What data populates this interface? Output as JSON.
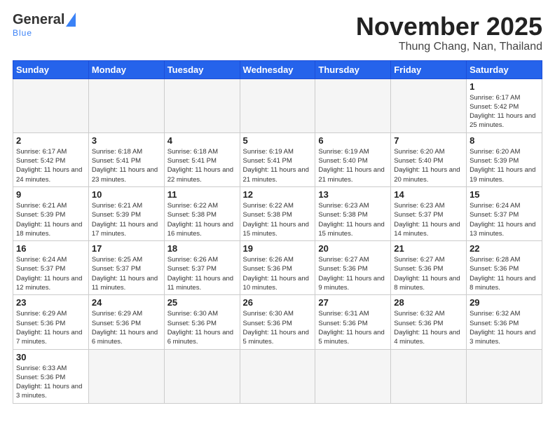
{
  "header": {
    "logo_general": "General",
    "logo_blue": "Blue",
    "title": "November 2025",
    "subtitle": "Thung Chang, Nan, Thailand"
  },
  "weekdays": [
    "Sunday",
    "Monday",
    "Tuesday",
    "Wednesday",
    "Thursday",
    "Friday",
    "Saturday"
  ],
  "weeks": [
    [
      {
        "day": "",
        "info": ""
      },
      {
        "day": "",
        "info": ""
      },
      {
        "day": "",
        "info": ""
      },
      {
        "day": "",
        "info": ""
      },
      {
        "day": "",
        "info": ""
      },
      {
        "day": "",
        "info": ""
      },
      {
        "day": "1",
        "info": "Sunrise: 6:17 AM\nSunset: 5:42 PM\nDaylight: 11 hours\nand 25 minutes."
      }
    ],
    [
      {
        "day": "2",
        "info": "Sunrise: 6:17 AM\nSunset: 5:42 PM\nDaylight: 11 hours\nand 24 minutes."
      },
      {
        "day": "3",
        "info": "Sunrise: 6:18 AM\nSunset: 5:41 PM\nDaylight: 11 hours\nand 23 minutes."
      },
      {
        "day": "4",
        "info": "Sunrise: 6:18 AM\nSunset: 5:41 PM\nDaylight: 11 hours\nand 22 minutes."
      },
      {
        "day": "5",
        "info": "Sunrise: 6:19 AM\nSunset: 5:41 PM\nDaylight: 11 hours\nand 21 minutes."
      },
      {
        "day": "6",
        "info": "Sunrise: 6:19 AM\nSunset: 5:40 PM\nDaylight: 11 hours\nand 21 minutes."
      },
      {
        "day": "7",
        "info": "Sunrise: 6:20 AM\nSunset: 5:40 PM\nDaylight: 11 hours\nand 20 minutes."
      },
      {
        "day": "8",
        "info": "Sunrise: 6:20 AM\nSunset: 5:39 PM\nDaylight: 11 hours\nand 19 minutes."
      }
    ],
    [
      {
        "day": "9",
        "info": "Sunrise: 6:21 AM\nSunset: 5:39 PM\nDaylight: 11 hours\nand 18 minutes."
      },
      {
        "day": "10",
        "info": "Sunrise: 6:21 AM\nSunset: 5:39 PM\nDaylight: 11 hours\nand 17 minutes."
      },
      {
        "day": "11",
        "info": "Sunrise: 6:22 AM\nSunset: 5:38 PM\nDaylight: 11 hours\nand 16 minutes."
      },
      {
        "day": "12",
        "info": "Sunrise: 6:22 AM\nSunset: 5:38 PM\nDaylight: 11 hours\nand 15 minutes."
      },
      {
        "day": "13",
        "info": "Sunrise: 6:23 AM\nSunset: 5:38 PM\nDaylight: 11 hours\nand 15 minutes."
      },
      {
        "day": "14",
        "info": "Sunrise: 6:23 AM\nSunset: 5:37 PM\nDaylight: 11 hours\nand 14 minutes."
      },
      {
        "day": "15",
        "info": "Sunrise: 6:24 AM\nSunset: 5:37 PM\nDaylight: 11 hours\nand 13 minutes."
      }
    ],
    [
      {
        "day": "16",
        "info": "Sunrise: 6:24 AM\nSunset: 5:37 PM\nDaylight: 11 hours\nand 12 minutes."
      },
      {
        "day": "17",
        "info": "Sunrise: 6:25 AM\nSunset: 5:37 PM\nDaylight: 11 hours\nand 11 minutes."
      },
      {
        "day": "18",
        "info": "Sunrise: 6:26 AM\nSunset: 5:37 PM\nDaylight: 11 hours\nand 11 minutes."
      },
      {
        "day": "19",
        "info": "Sunrise: 6:26 AM\nSunset: 5:36 PM\nDaylight: 11 hours\nand 10 minutes."
      },
      {
        "day": "20",
        "info": "Sunrise: 6:27 AM\nSunset: 5:36 PM\nDaylight: 11 hours\nand 9 minutes."
      },
      {
        "day": "21",
        "info": "Sunrise: 6:27 AM\nSunset: 5:36 PM\nDaylight: 11 hours\nand 8 minutes."
      },
      {
        "day": "22",
        "info": "Sunrise: 6:28 AM\nSunset: 5:36 PM\nDaylight: 11 hours\nand 8 minutes."
      }
    ],
    [
      {
        "day": "23",
        "info": "Sunrise: 6:29 AM\nSunset: 5:36 PM\nDaylight: 11 hours\nand 7 minutes."
      },
      {
        "day": "24",
        "info": "Sunrise: 6:29 AM\nSunset: 5:36 PM\nDaylight: 11 hours\nand 6 minutes."
      },
      {
        "day": "25",
        "info": "Sunrise: 6:30 AM\nSunset: 5:36 PM\nDaylight: 11 hours\nand 6 minutes."
      },
      {
        "day": "26",
        "info": "Sunrise: 6:30 AM\nSunset: 5:36 PM\nDaylight: 11 hours\nand 5 minutes."
      },
      {
        "day": "27",
        "info": "Sunrise: 6:31 AM\nSunset: 5:36 PM\nDaylight: 11 hours\nand 5 minutes."
      },
      {
        "day": "28",
        "info": "Sunrise: 6:32 AM\nSunset: 5:36 PM\nDaylight: 11 hours\nand 4 minutes."
      },
      {
        "day": "29",
        "info": "Sunrise: 6:32 AM\nSunset: 5:36 PM\nDaylight: 11 hours\nand 3 minutes."
      }
    ],
    [
      {
        "day": "30",
        "info": "Sunrise: 6:33 AM\nSunset: 5:36 PM\nDaylight: 11 hours\nand 3 minutes."
      },
      {
        "day": "",
        "info": ""
      },
      {
        "day": "",
        "info": ""
      },
      {
        "day": "",
        "info": ""
      },
      {
        "day": "",
        "info": ""
      },
      {
        "day": "",
        "info": ""
      },
      {
        "day": "",
        "info": ""
      }
    ]
  ]
}
